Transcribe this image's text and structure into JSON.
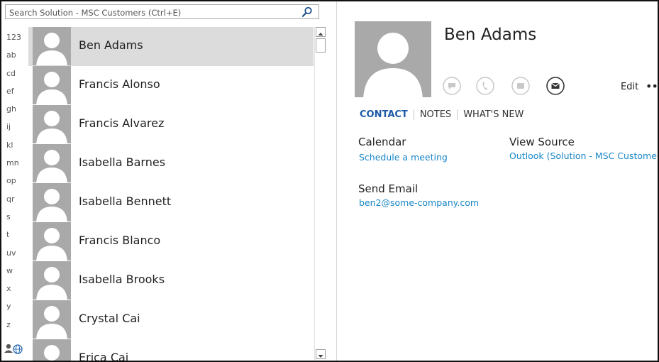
{
  "search": {
    "placeholder": "Search Solution - MSC Customers (Ctrl+E)"
  },
  "alphabet": [
    "123",
    "ab",
    "cd",
    "ef",
    "gh",
    "ij",
    "kl",
    "mn",
    "op",
    "qr",
    "s",
    "t",
    "uv",
    "w",
    "x",
    "y",
    "z"
  ],
  "contacts": [
    {
      "name": "Ben Adams",
      "selected": true
    },
    {
      "name": "Francis Alonso",
      "selected": false
    },
    {
      "name": "Francis Alvarez",
      "selected": false
    },
    {
      "name": "Isabella Barnes",
      "selected": false
    },
    {
      "name": "Isabella Bennett",
      "selected": false
    },
    {
      "name": "Francis Blanco",
      "selected": false
    },
    {
      "name": "Isabella Brooks",
      "selected": false
    },
    {
      "name": "Crystal Cai",
      "selected": false
    },
    {
      "name": "Erica Cai",
      "selected": false
    }
  ],
  "detail": {
    "name": "Ben Adams",
    "edit_label": "Edit",
    "more_label": "•••",
    "actions": [
      "chat-icon",
      "phone-icon",
      "meeting-icon",
      "mail-icon"
    ],
    "tabs": [
      "CONTACT",
      "NOTES",
      "WHAT'S NEW"
    ],
    "active_tab": "CONTACT",
    "calendar": {
      "label": "Calendar",
      "link": "Schedule a meeting"
    },
    "view_source": {
      "label": "View Source",
      "link": "Outlook (Solution - MSC Custome..."
    },
    "send_email": {
      "label": "Send Email",
      "link": "ben2@some-company.com"
    }
  },
  "colors": {
    "accent": "#1e5aa8",
    "link": "#1a86c8",
    "selected_row": "#dcdcdc",
    "avatar": "#a9a9a9"
  }
}
